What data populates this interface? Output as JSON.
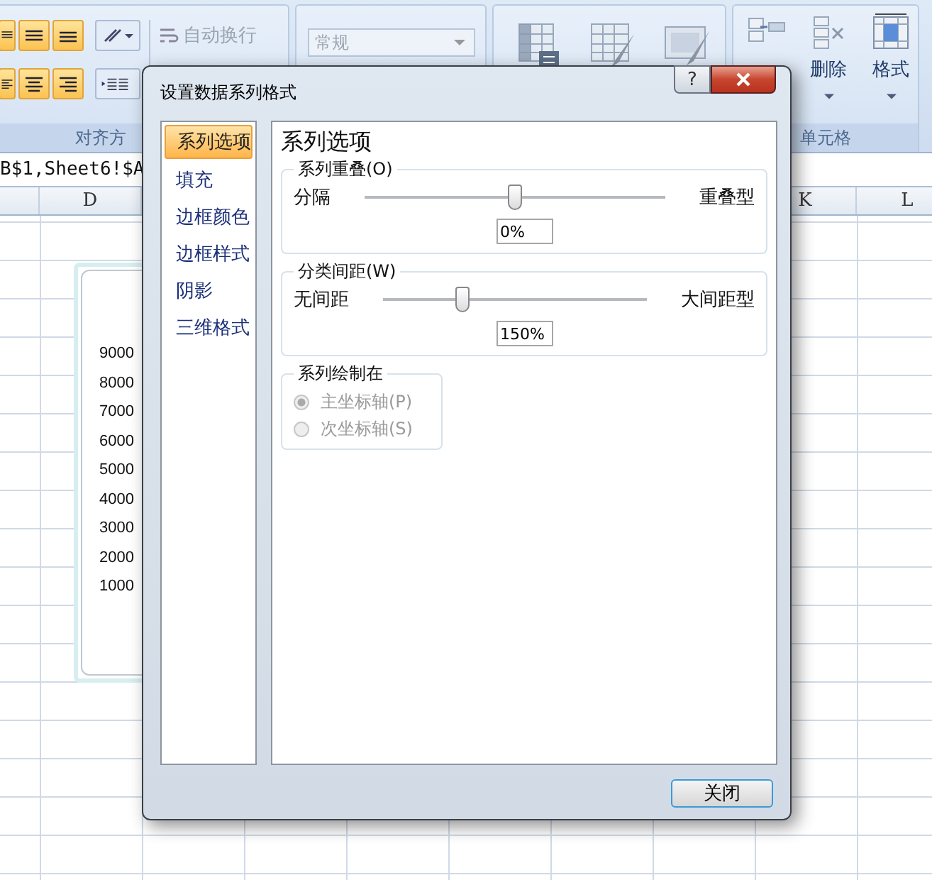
{
  "ribbon": {
    "alignment_group": {
      "label": "对齐方",
      "wrap_text_button": "自动换行"
    },
    "number_group": {
      "format_dropdown": {
        "value": "常规",
        "disabled": true
      }
    },
    "cells_group": {
      "label": "单元格",
      "buttons": [
        "删除",
        "格式"
      ]
    }
  },
  "formula_bar": {
    "text": "B$1,Sheet6!$A"
  },
  "column_headers": [
    "D",
    "K",
    "L"
  ],
  "chart": {
    "axis_labels": [
      "9000",
      "8000",
      "7000",
      "6000",
      "5000",
      "4000",
      "3000",
      "2000",
      "1000"
    ]
  },
  "dialog": {
    "title": "设置数据系列格式",
    "help_button": "?",
    "nav": [
      {
        "label": "系列选项",
        "selected": true
      },
      {
        "label": "填充",
        "selected": false
      },
      {
        "label": "边框颜色",
        "selected": false
      },
      {
        "label": "边框样式",
        "selected": false
      },
      {
        "label": "阴影",
        "selected": false
      },
      {
        "label": "三维格式",
        "selected": false
      }
    ],
    "heading": "系列选项",
    "sections": [
      {
        "kind": "slider",
        "title": "系列重叠(O)",
        "left_label": "分隔",
        "right_label": "重叠型",
        "level": 0.5,
        "value": "0%"
      },
      {
        "kind": "slider",
        "title": "分类间距(W)",
        "left_label": "无间距",
        "right_label": "大间距型",
        "level": 0.3,
        "value": "150%"
      },
      {
        "kind": "radio",
        "title": "系列绘制在",
        "options": [
          {
            "label": "主坐标轴(P)",
            "selected": true,
            "disabled": true
          },
          {
            "label": "次坐标轴(S)",
            "selected": false,
            "disabled": true
          }
        ]
      }
    ],
    "close_button": "关闭"
  }
}
